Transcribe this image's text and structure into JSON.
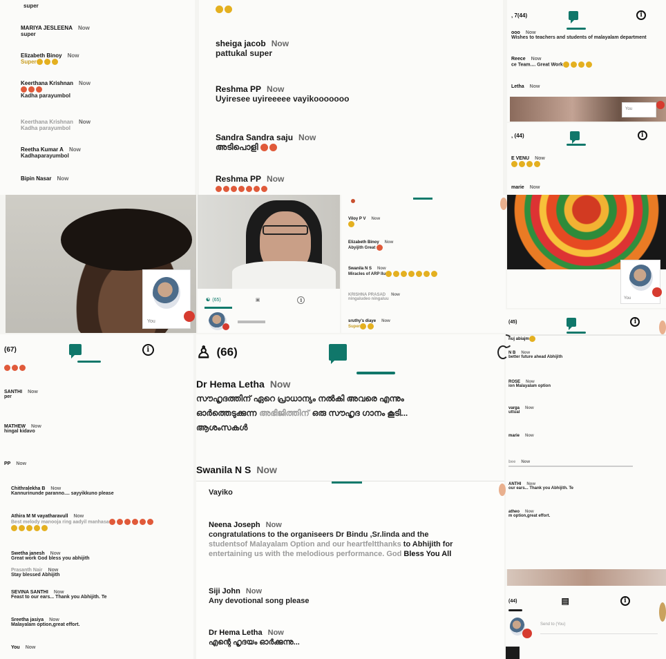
{
  "top_left_chat": {
    "messages": [
      {
        "name": "",
        "time": "",
        "text": "super"
      },
      {
        "name": "MARIYA JESLEENA",
        "time": "Now",
        "text": "super"
      },
      {
        "name": "Elizabeth Binoy",
        "time": "Now",
        "text": "Super"
      },
      {
        "name": "Keerthana Krishnan",
        "time": "Now",
        "text": ""
      },
      {
        "name": "",
        "time": "",
        "text": "Kadha parayumbol"
      },
      {
        "name": "Keerthana Krishnan",
        "time": "Now",
        "text": "Kadha parayumbol"
      },
      {
        "name": "Reetha Kumar A",
        "time": "Now",
        "text": "Kadhaparayumbol"
      },
      {
        "name": "Bipin Nasar",
        "time": "Now",
        "text": ""
      }
    ]
  },
  "top_center_chat": {
    "messages": [
      {
        "name": "sheiga jacob",
        "time": "Now",
        "text": "pattukal super"
      },
      {
        "name": "Reshma PP",
        "time": "Now",
        "text": "Uyiresee uyireeeee vayikooooooo"
      },
      {
        "name": "Sandra Sandra saju",
        "time": "Now",
        "text": "അടിപൊളി"
      },
      {
        "name": "Reshma PP",
        "time": "Now",
        "text": ""
      }
    ]
  },
  "top_right_panel_1": {
    "count": ", 7(44)",
    "messages": [
      {
        "name": "ooo",
        "time": "Now",
        "text": "Wishes to teachers and students of malayalam department"
      },
      {
        "name": "Reece",
        "time": "Now",
        "text": "ce Team.... Great Work"
      },
      {
        "name": "Letha",
        "time": "Now",
        "text": ""
      }
    ],
    "you_label": "You"
  },
  "top_right_panel_2": {
    "count": ", (44)",
    "messages": [
      {
        "name": "E VENU",
        "time": "Now",
        "text": ""
      },
      {
        "name": "marie",
        "time": "Now",
        "text": ""
      }
    ],
    "you_label": "You"
  },
  "middle_left_video": {
    "you_label": "You"
  },
  "middle_center_video": {
    "people_count": "(65)"
  },
  "middle_right_chat": {
    "messages": [
      {
        "name": "Viloy P V",
        "time": "Now",
        "text": ""
      },
      {
        "name": "Elizabeth Binoy",
        "time": "Now",
        "text": "Abyijith Great"
      },
      {
        "name": "Swanila N S",
        "time": "Now",
        "text": "Miracles of ARP Ilu"
      },
      {
        "name": "KRISHNA PRASAD",
        "time": "Now",
        "text": "ningaludeo ningaluu"
      },
      {
        "name": "sruthy's diaye",
        "time": "Now",
        "text": "Super"
      }
    ]
  },
  "bottom_left_panel": {
    "count": "(67)",
    "messages": [
      {
        "name": "SANTHI",
        "time": "Now",
        "text": "per"
      },
      {
        "name": "MATHEW",
        "time": "Now",
        "text": "hingal kidavo"
      },
      {
        "name": "PP",
        "time": "Now",
        "text": ""
      },
      {
        "name": "Chithralekha B",
        "time": "Now",
        "text": "Kannurinunde paranno.... sayyikkuno please"
      },
      {
        "name": "Athira M M vayatharavull",
        "time": "Now",
        "text": "Best melody manooja ring aadyil manhasa"
      },
      {
        "name": "Swetha janesh",
        "time": "Now",
        "text": "Great work God bless you abhijith"
      },
      {
        "name": "Prasanth Nair",
        "time": "Now",
        "text": "Stay blessed Abhijith"
      },
      {
        "name": "SEVINA SANTHI",
        "time": "Now",
        "text": "Feast to our ears... Thank you Abhijith. Te"
      },
      {
        "name": "Sreetha jasiya",
        "time": "Now",
        "text": "Malayalam option,great effort."
      },
      {
        "name": "You",
        "time": "Now",
        "text": ""
      }
    ]
  },
  "bottom_center_chat": {
    "people_count": "(66)",
    "messages": [
      {
        "name": "Dr Hema Letha",
        "time": "Now",
        "text_line1": "സൗഹൃദത്തിന് ഏറെ പ്രാധാന്യം നൽകി അവരെ എന്നും",
        "text_line2a": "ഓർത്തെടുക്കുന്ന",
        "text_line2b": "അഭിജിത്തിന്",
        "text_line2c": "ഒരു സൗഹൃദ ഗാനം കൂടി...",
        "text_line3": "ആശംസകൾ"
      },
      {
        "name": "Swanila N S",
        "time": "Now",
        "text": "Vayiko"
      },
      {
        "name": "Neena Joseph",
        "time": "Now",
        "text_line1": "congratulations to the organiseers Dr Bindu ,Sr.linda and the",
        "text_line2a": "studentsof Malayalam Option and our heartfeltthanks",
        "text_line2b": "to Abhijith for",
        "text_line3a": "entertaining us with the melodious performance. God",
        "text_line3b": "Bless You All"
      },
      {
        "name": "Siji John",
        "time": "Now",
        "text": "Any devotional song please"
      },
      {
        "name": "Dr Hema Letha",
        "time": "Now",
        "text": "എന്റെ ഹൃദയം ഓർക്കുന്നു..."
      }
    ]
  },
  "bottom_right_panel_1": {
    "count": "(45)",
    "messages": [
      {
        "name": "nuj abiajm",
        "time": "",
        "text": ""
      },
      {
        "name": "N B",
        "time": "Now",
        "text": "better future ahead Abhijith"
      },
      {
        "name": "ROSE",
        "time": "Now",
        "text": "ion Malayalam option"
      },
      {
        "name": "varga",
        "time": "Now",
        "text": "uttual"
      },
      {
        "name": "marie",
        "time": "Now",
        "text": ""
      },
      {
        "name": "bee",
        "time": "Now",
        "text": ""
      },
      {
        "name": "ANTHI",
        "time": "Now",
        "text": "our ears... Thank you Abhijith. Te"
      },
      {
        "name": "atheo",
        "time": "Now",
        "text": "m option,great effort."
      }
    ]
  },
  "bottom_right_panel_2": {
    "count": "(44)",
    "send_placeholder": "Send to (You)"
  },
  "colors": {
    "accent": "#10776a",
    "badge": "#d63b2f",
    "emoji": "#e4b020"
  }
}
